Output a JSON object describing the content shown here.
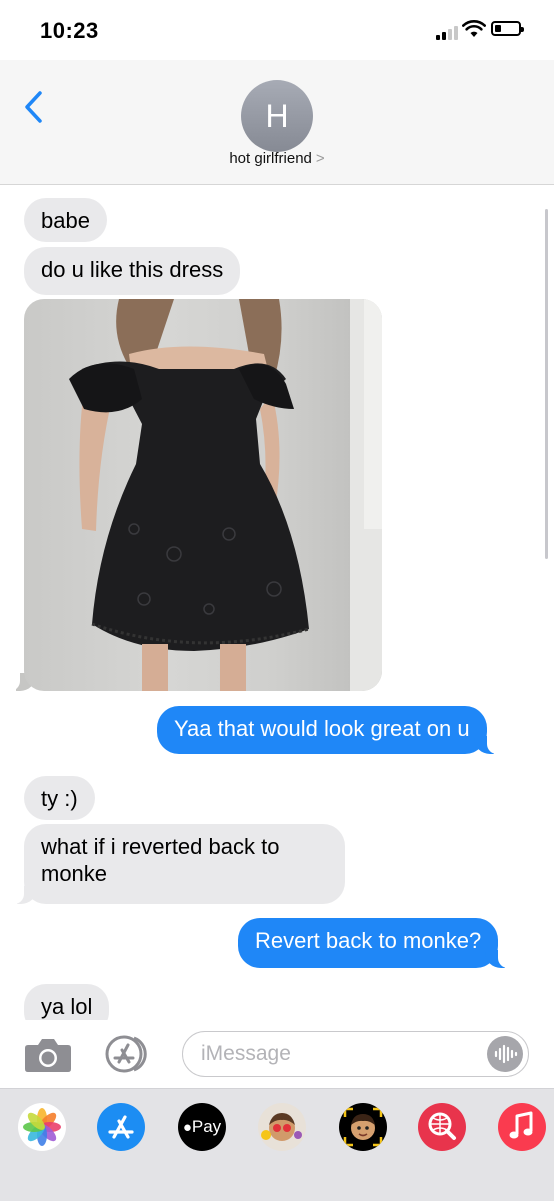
{
  "status_bar": {
    "time": "10:23"
  },
  "header": {
    "avatar_initial": "H",
    "contact_name": "hot girlfriend",
    "contact_chevron": ">"
  },
  "messages": [
    {
      "from": "them",
      "text": "babe"
    },
    {
      "from": "them",
      "text": "do u like this dress"
    },
    {
      "from": "them",
      "type": "photo",
      "icon": "black-dress-photo"
    },
    {
      "from": "me",
      "text": "Yaa that would look great on u"
    },
    {
      "from": "them",
      "text": "ty :)"
    },
    {
      "from": "them",
      "text": "what if i reverted back to monke"
    },
    {
      "from": "me",
      "text": "Revert back to monke?"
    },
    {
      "from": "them",
      "text": "ya lol"
    }
  ],
  "input": {
    "placeholder": "iMessage"
  },
  "app_tray": {
    "items": [
      {
        "icon": "photos-icon"
      },
      {
        "icon": "app-store-icon"
      },
      {
        "icon": "apple-pay-icon",
        "label": "Pay"
      },
      {
        "icon": "memoji-stickers-icon"
      },
      {
        "icon": "animoji-icon"
      },
      {
        "icon": "web-search-icon"
      },
      {
        "icon": "music-icon"
      }
    ]
  },
  "colors": {
    "outgoing_bubble": "#1f87f7",
    "incoming_bubble": "#e9e9eb",
    "accent": "#1f87f7",
    "music_red": "#fa3b4f"
  }
}
